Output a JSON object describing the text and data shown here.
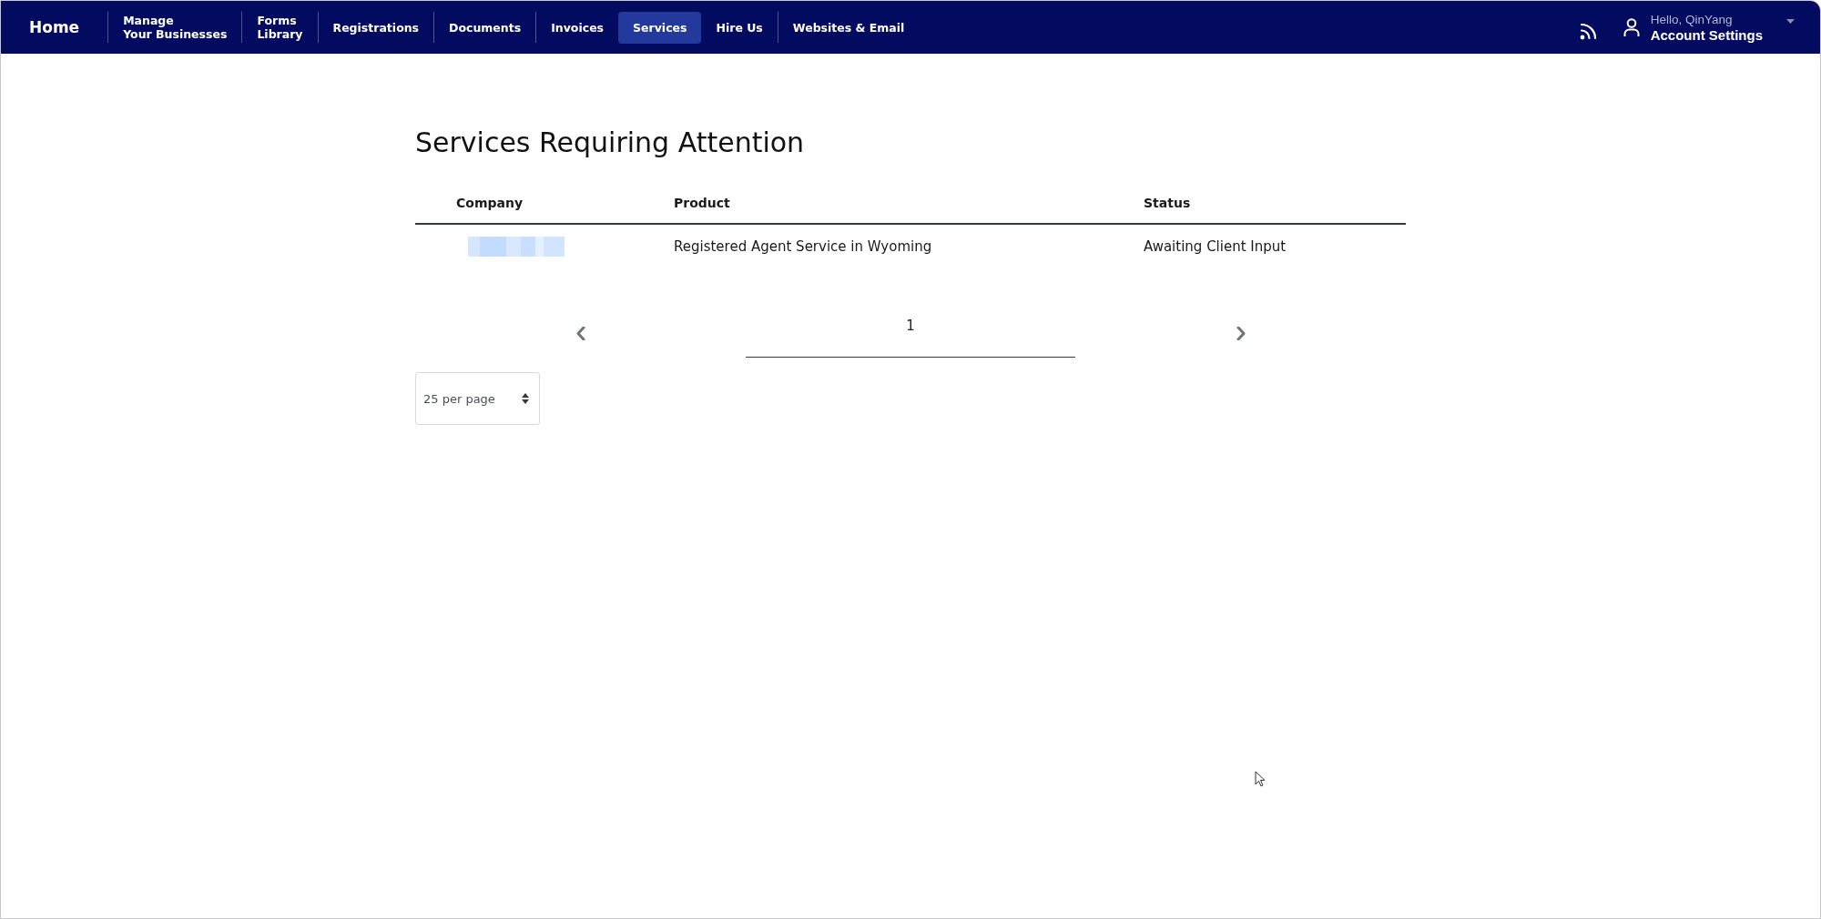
{
  "nav": {
    "home": "Home",
    "items": [
      {
        "lines": [
          "Manage",
          "Your Businesses"
        ],
        "selected": false
      },
      {
        "lines": [
          "Forms",
          "Library"
        ],
        "selected": false
      },
      {
        "lines": [
          "Registrations"
        ],
        "selected": false
      },
      {
        "lines": [
          "Documents"
        ],
        "selected": false
      },
      {
        "lines": [
          "Invoices"
        ],
        "selected": false
      },
      {
        "lines": [
          "Services"
        ],
        "selected": true
      },
      {
        "lines": [
          "Hire Us"
        ],
        "selected": false
      },
      {
        "lines": [
          "Websites & Email"
        ],
        "selected": false
      }
    ],
    "account": {
      "greeting": "Hello, QinYang",
      "label": "Account Settings"
    }
  },
  "page": {
    "title": "Services Requiring Attention"
  },
  "table": {
    "columns": [
      "Company",
      "Product",
      "Status"
    ],
    "rows": [
      {
        "company_redacted": true,
        "product": "Registered Agent Service in Wyoming",
        "status": "Awaiting Client Input"
      }
    ]
  },
  "pagination": {
    "pages": [
      {
        "label": "1",
        "selected": true
      }
    ]
  },
  "per_page": {
    "value": "25 per page"
  }
}
